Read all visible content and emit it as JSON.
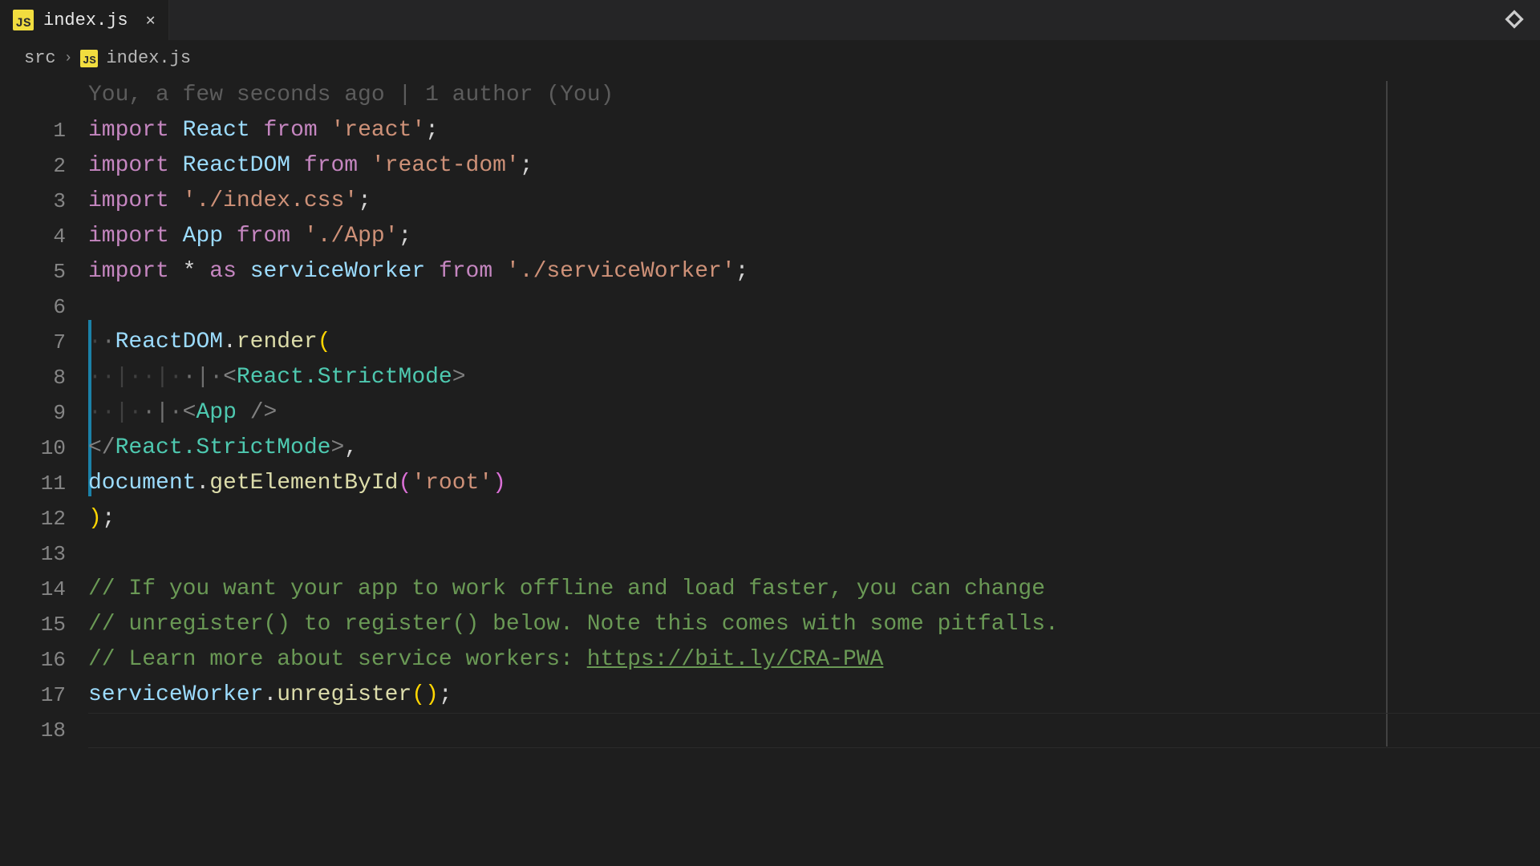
{
  "tab": {
    "icon": "JS",
    "filename": "index.js"
  },
  "breadcrumbs": {
    "folder": "src",
    "file_icon": "JS",
    "file": "index.js"
  },
  "git_blame": "You, a few seconds ago | 1 author (You)",
  "line_numbers": [
    "1",
    "2",
    "3",
    "4",
    "5",
    "6",
    "7",
    "8",
    "9",
    "10",
    "11",
    "12",
    "13",
    "14",
    "15",
    "16",
    "17",
    "18"
  ],
  "tokens": {
    "import": "import",
    "from": "from",
    "as": "as",
    "star": "*",
    "React": "React",
    "ReactDOM": "ReactDOM",
    "App": "App",
    "serviceWorker": "serviceWorker",
    "document": "document",
    "react_str": "'react'",
    "reactdom_str": "'react-dom'",
    "indexcss_str": "'./index.css'",
    "app_str": "'./App'",
    "sw_str": "'./serviceWorker'",
    "root_str": "'root'",
    "render": "render",
    "getElementById": "getElementById",
    "unregister": "unregister",
    "StrictMode_open": "React.StrictMode",
    "StrictMode_close": "React.StrictMode",
    "App_tag": "App",
    "semi": ";",
    "dot": ".",
    "comma": ",",
    "lp": "(",
    "rp": ")",
    "lp2": "(",
    "rp2": ")",
    "lt": "<",
    "gt": ">",
    "lslash": "</",
    "slashgt": " />",
    "cmt1": "// If you want your app to work offline and load faster, you can change",
    "cmt2": "// unregister() to register() below. Note this comes with some pitfalls.",
    "cmt3a": "// Learn more about service workers: ",
    "cmt3link": "https://bit.ly/CRA-PWA"
  }
}
